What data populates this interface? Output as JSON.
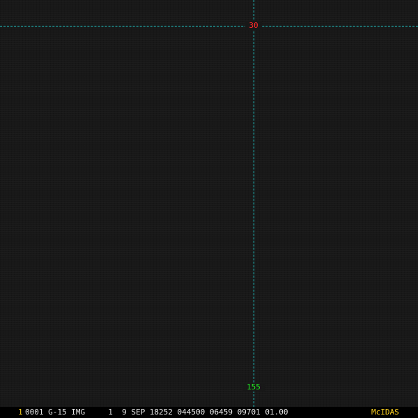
{
  "map_overlay": {
    "latitude_label": "30",
    "longitude_label": "155",
    "grid_color": "#1fd6d6",
    "latitude_label_color": "#ff2a2a",
    "longitude_label_color": "#22e022"
  },
  "status_bar": {
    "frame_number": "1",
    "image_info": "0001 G-15 IMG     1  9 SEP 18252 044500 06459 09701 01.00",
    "brand": "McIDAS",
    "text_color": "#e6e6e6",
    "accent_color": "#ffd21f"
  }
}
